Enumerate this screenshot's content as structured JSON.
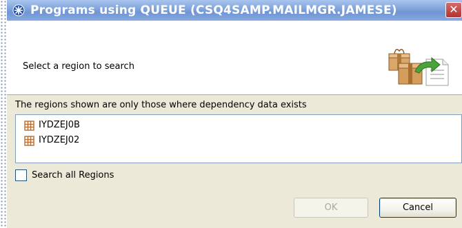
{
  "window": {
    "title": "Programs using QUEUE (CSQ4SAMP.MAILMGR.JAMESE)",
    "close_glyph": "✕"
  },
  "header": {
    "prompt": "Select a region to search",
    "graphic_icon": "package-export-icon"
  },
  "regions": {
    "info_label": "The regions shown are only those where dependency data exists",
    "items": [
      {
        "label": "IYDZEJ0B",
        "icon": "region-grid-icon"
      },
      {
        "label": "IYDZEJ02",
        "icon": "region-grid-icon"
      }
    ]
  },
  "search_all": {
    "label": "Search all Regions",
    "checked": false
  },
  "buttons": {
    "ok": {
      "label": "OK",
      "enabled": false
    },
    "cancel": {
      "label": "Cancel",
      "enabled": true
    }
  },
  "colors": {
    "titlebar": "#7ea2da",
    "dialog_bg": "#ece9d8",
    "region_icon": "#b8733a"
  }
}
